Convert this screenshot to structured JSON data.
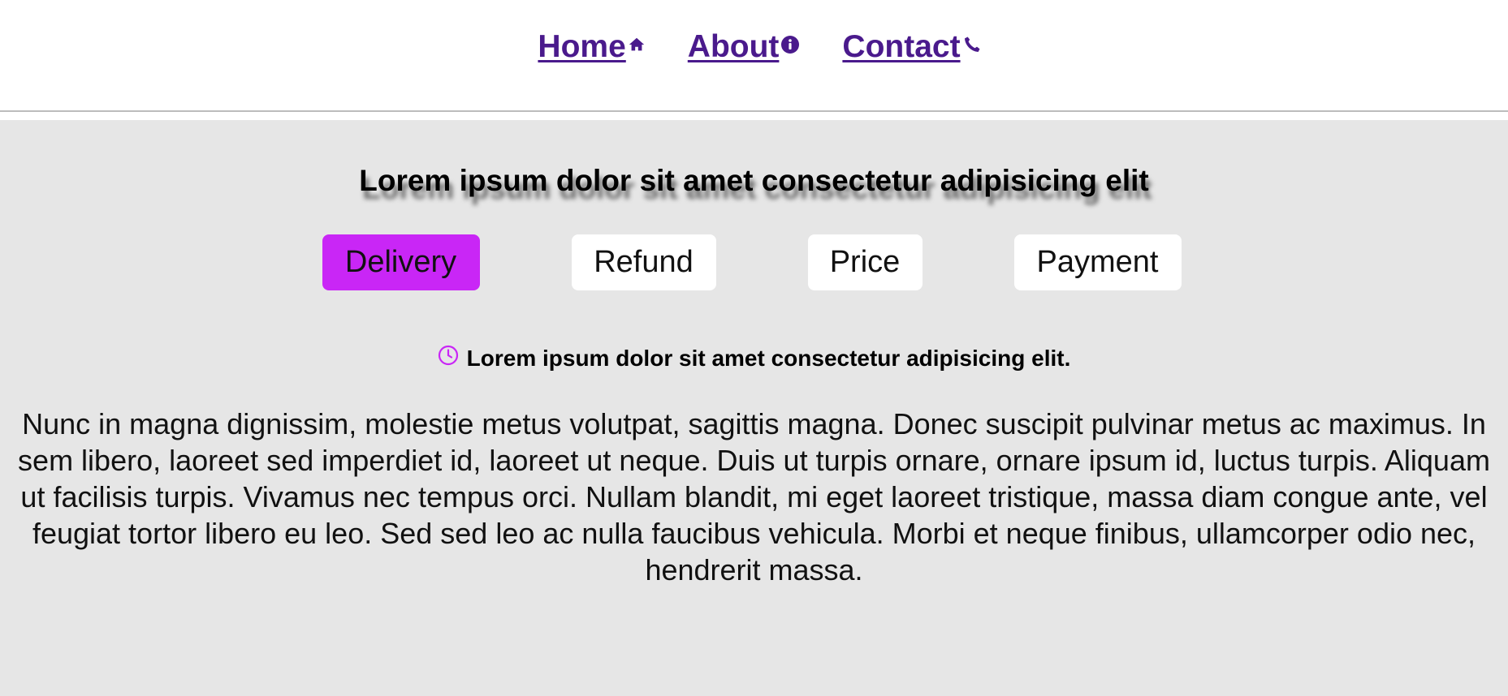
{
  "nav": {
    "items": [
      {
        "label": "Home",
        "icon": "home-icon"
      },
      {
        "label": "About",
        "icon": "info-icon"
      },
      {
        "label": "Contact",
        "icon": "phone-icon"
      }
    ]
  },
  "main": {
    "title": "Lorem ipsum dolor sit amet consectetur adipisicing elit",
    "tabs": [
      {
        "label": "Delivery",
        "active": true
      },
      {
        "label": "Refund",
        "active": false
      },
      {
        "label": "Price",
        "active": false
      },
      {
        "label": "Payment",
        "active": false
      }
    ],
    "subtitle": "Lorem ipsum dolor sit amet consectetur adipisicing elit.",
    "subtitle_icon": "clock-icon",
    "body": "Nunc in magna dignissim, molestie metus volutpat, sagittis magna. Donec suscipit pulvinar metus ac maximus. In sem libero, laoreet sed imperdiet id, laoreet ut neque. Duis ut turpis ornare, ornare ipsum id, luctus turpis. Aliquam ut facilisis turpis. Vivamus nec tempus orci. Nullam blandit, mi eget laoreet tristique, massa diam congue ante, vel feugiat tortor libero eu leo. Sed sed leo ac nulla faucibus vehicula. Morbi et neque finibus, ullamcorper odio nec, hendrerit massa."
  },
  "colors": {
    "nav_link": "#4a1a8c",
    "accent": "#c926f6",
    "background": "#e6e6e6"
  }
}
